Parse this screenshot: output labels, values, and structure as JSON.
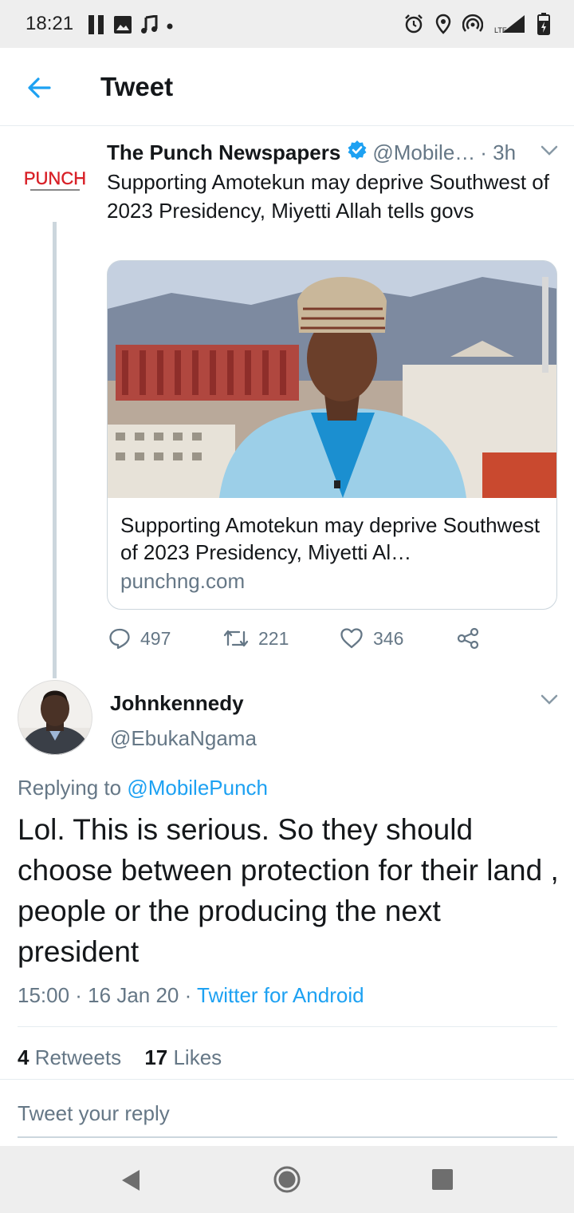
{
  "status_bar": {
    "time": "18:21",
    "left_icons": [
      "pause-icon",
      "image-icon",
      "music-note-icon",
      "dot-icon"
    ],
    "right_icons": [
      "alarm-icon",
      "location-icon",
      "hotspot-icon",
      "lte-signal-icon",
      "battery-icon"
    ],
    "lte_label": "LTE"
  },
  "header": {
    "title": "Tweet",
    "back_icon": "arrow-left-icon"
  },
  "quoted_tweet": {
    "author_name": "The Punch Newspapers",
    "verified": true,
    "handle": "@Mobile…",
    "time": "· 3h",
    "avatar_text": "PUNCH",
    "text": "Supporting Amotekun may deprive Southwest of 2023 Presidency, Miyetti Allah tells govs",
    "card": {
      "title": "Supporting Amotekun may deprive Southwest of 2023 Presidency, Miyetti Al…",
      "domain": "punchng.com"
    },
    "actions": {
      "replies": "497",
      "retweets": "221",
      "likes": "346"
    }
  },
  "reply_tweet": {
    "author_name": "Johnkennedy",
    "handle": "@EbukaNgama",
    "replying_prefix": "Replying to ",
    "replying_to": "@MobilePunch",
    "text": "Lol. This is serious. So they should choose between protection for their land , people or the producing the next president",
    "timestamp": "15:00 · 16 Jan 20 · ",
    "source": "Twitter for Android",
    "retweets_count": "4",
    "retweets_label": " Retweets",
    "likes_count": "17",
    "likes_label": " Likes"
  },
  "reply_input": {
    "placeholder": "Tweet your reply"
  },
  "colors": {
    "accent": "#1da1f2",
    "secondary_text": "#657786",
    "primary_text": "#14171a",
    "divider": "#e6ecf0"
  }
}
